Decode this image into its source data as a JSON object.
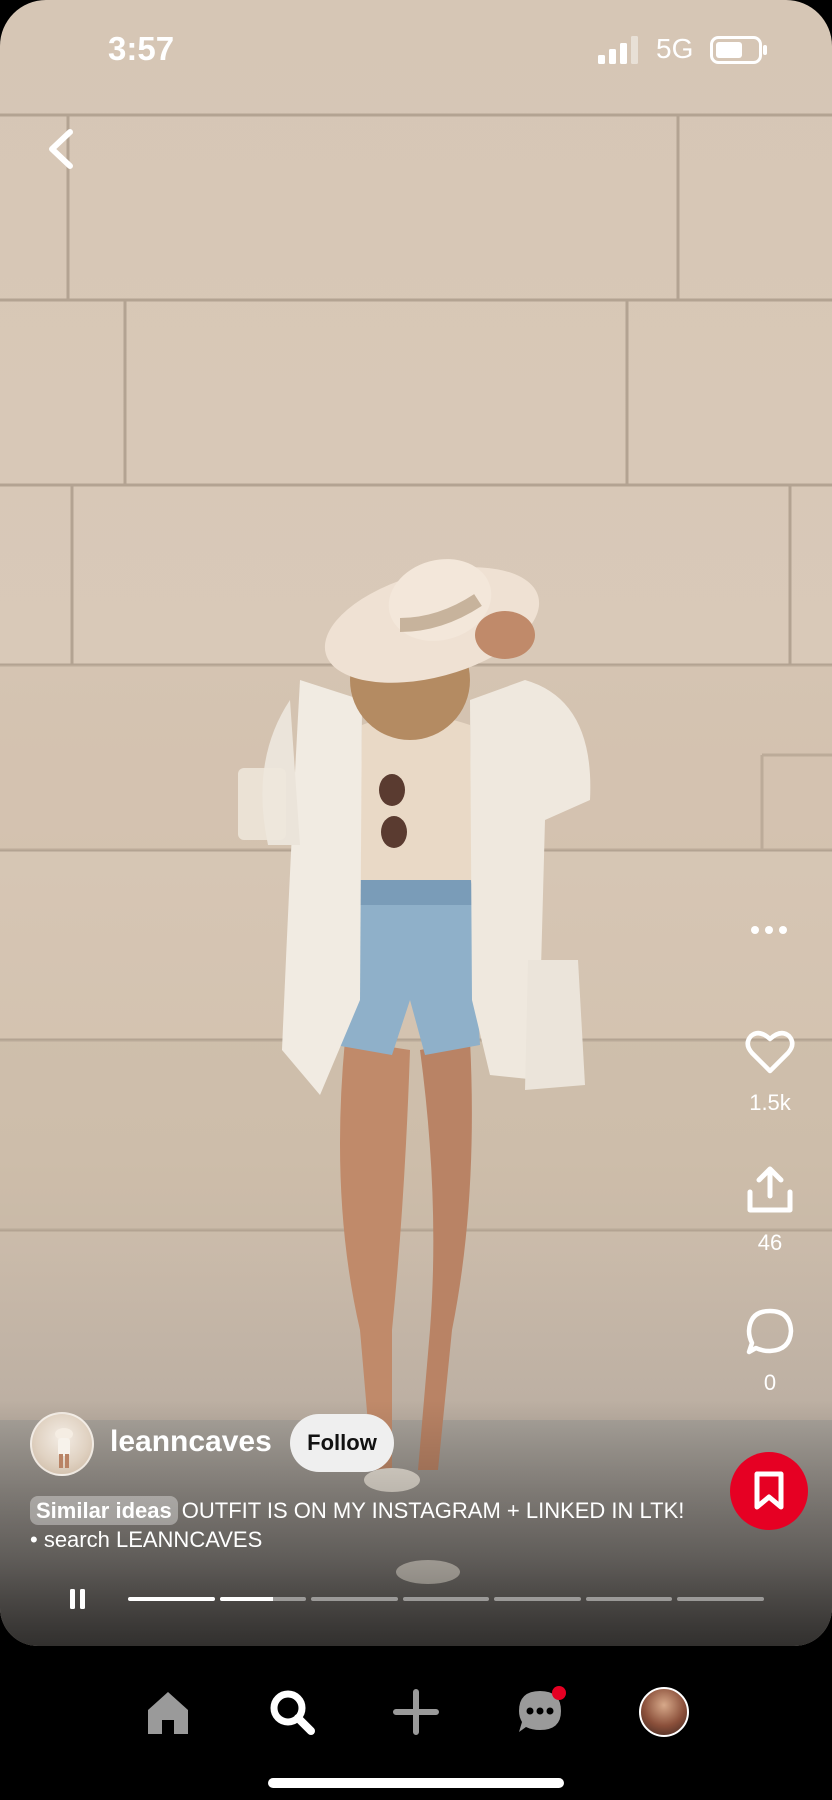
{
  "status_bar": {
    "time": "3:57",
    "network": "5G"
  },
  "pin": {
    "creator": {
      "username": "leanncaves"
    },
    "follow_label": "Follow",
    "caption": {
      "tag": "Similar ideas",
      "text": "OUTFIT IS ON MY INSTAGRAM + LINKED IN LTK! • search LEANNCAVES"
    },
    "stats": {
      "likes": "1.5k",
      "shares": "46",
      "comments": "0"
    },
    "story_progress": {
      "segments": 7,
      "current_segment": 2,
      "current_fill": 0.62
    }
  },
  "icons": {
    "back": "chevron-left-icon",
    "more": "more-dots-icon",
    "like": "heart-icon",
    "share": "share-icon",
    "comment": "comment-icon",
    "save": "bookmark-icon",
    "pause": "pause-icon",
    "nav": [
      "home-icon",
      "search-icon",
      "plus-icon",
      "messages-icon",
      "profile-avatar"
    ]
  },
  "colors": {
    "accent": "#e60023",
    "nav_bg": "#000000"
  }
}
